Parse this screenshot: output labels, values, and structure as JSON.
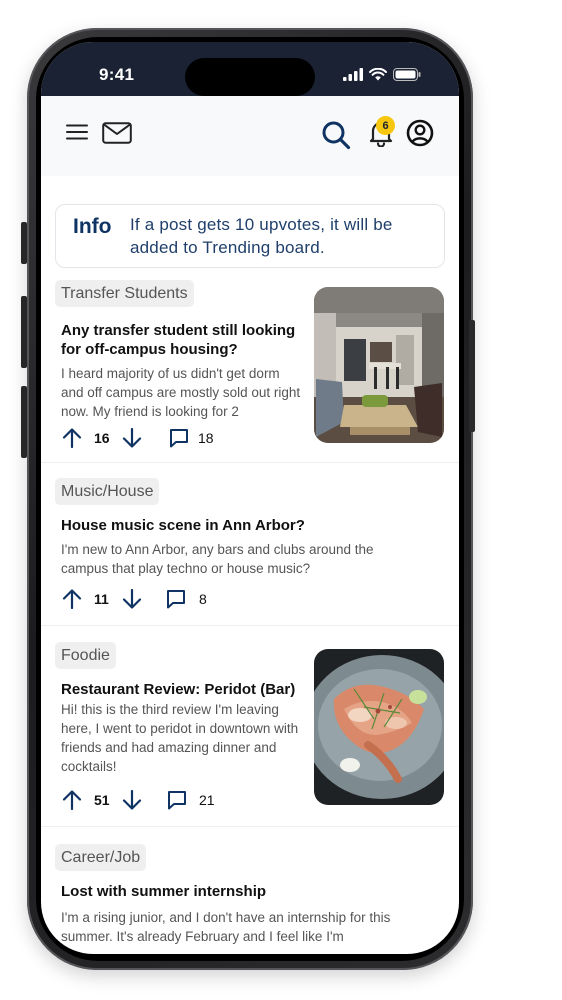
{
  "status_bar": {
    "time": "9:41"
  },
  "header": {
    "notification_count": "6"
  },
  "info": {
    "title": "Info",
    "text": "If a post gets 10 upvotes, it will be added to Trending board."
  },
  "posts": [
    {
      "tag": "Transfer Students",
      "title": "Any transfer student still looking for off-campus housing?",
      "body": "I heard majority of us didn't get dorm and off campus are mostly sold out right now. My friend is looking for 2",
      "votes": "16",
      "comments": "18"
    },
    {
      "tag": "Music/House",
      "title": "House music scene in Ann Arbor?",
      "body": "I'm new to Ann Arbor, any bars and clubs around the campus that play techno or house music?",
      "votes": "11",
      "comments": "8"
    },
    {
      "tag": "Foodie",
      "title": "Restaurant Review: Peridot (Bar)",
      "body": "Hi! this is the third review I'm leaving here, I went to peridot in downtown with friends and had amazing dinner and cocktails!",
      "votes": "51",
      "comments": "21"
    },
    {
      "tag": "Career/Job",
      "title": "Lost with summer internship",
      "body": "I'm a rising junior, and I don't have an internship for this summer. It's already February and I feel like I'm"
    }
  ],
  "colors": {
    "navy": "#0f3463",
    "status_bar": "#1a2233",
    "badge": "#f6c70e"
  }
}
